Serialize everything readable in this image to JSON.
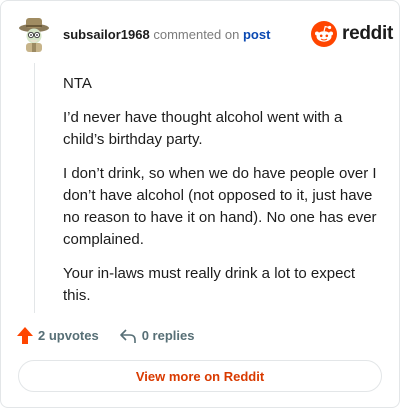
{
  "header": {
    "username": "subsailor1968",
    "action_text": "commented on",
    "post_link": "post",
    "logo_wordmark": "reddit",
    "avatar_icon": "explorer-avatar-icon"
  },
  "comment": {
    "paragraphs": [
      "NTA",
      "I’d never have thought alcohol went with a child’s birthday party.",
      "I don’t drink, so when we do have people over I don’t have alcohol (not opposed to it, just have no reason to have it on hand). No one has ever complained.",
      "Your in-laws must really drink a lot to expect this."
    ]
  },
  "actions": {
    "upvotes_label": "2 upvotes",
    "replies_label": "0 replies"
  },
  "footer": {
    "view_more_label": "View more on Reddit"
  },
  "colors": {
    "brand": "#ff4500",
    "link": "#0a49b2",
    "muted": "#576f76"
  }
}
